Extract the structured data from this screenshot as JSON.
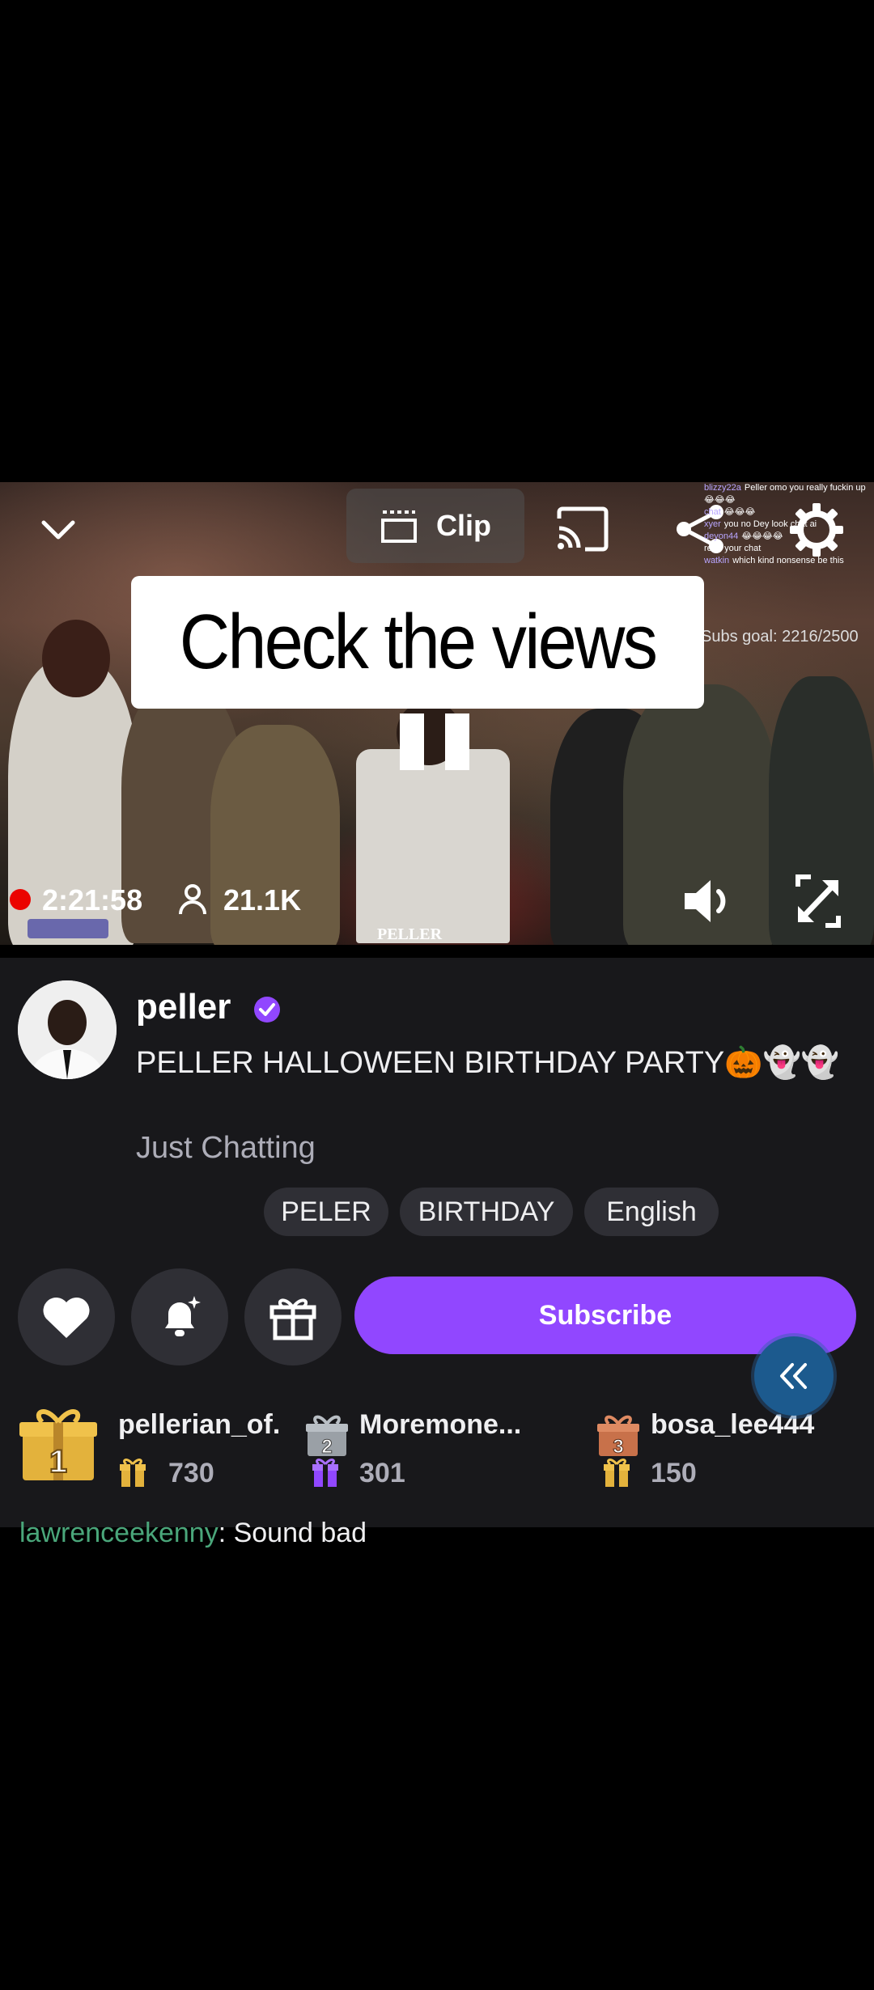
{
  "player": {
    "clip_label": "Clip",
    "caption": "Check the views",
    "uptime": "2:21:58",
    "viewers": "21.1K",
    "watermark": "PELLER",
    "subs_goal": "Subs goal: 2216/2500",
    "overlay_chat": [
      {
        "user": "blizzy22a",
        "text": "Peller omo you really fuckin up"
      },
      {
        "user": "",
        "text": "😂😂😂"
      },
      {
        "user": "chat",
        "text": "😂😂😂"
      },
      {
        "user": "xyer",
        "text": "you no Dey look chat ai"
      },
      {
        "user": "deyon44",
        "text": "😂😂😂😂"
      },
      {
        "user": "",
        "text": "read your chat"
      },
      {
        "user": "watkin",
        "text": "which kind nonsense be this"
      }
    ]
  },
  "channel": {
    "name": "peller",
    "title": "PELLER HALLOWEEN BIRTHDAY PARTY🎃👻👻",
    "category": "Just Chatting",
    "tags": [
      "PELER",
      "BIRTHDAY",
      "English"
    ]
  },
  "actions": {
    "subscribe_label": "Subscribe"
  },
  "gifters": [
    {
      "rank": "1",
      "name": "pellerian_of.",
      "count": "730"
    },
    {
      "rank": "2",
      "name": "Moremone...",
      "count": "301"
    },
    {
      "rank": "3",
      "name": "bosa_lee444",
      "count": "150"
    }
  ],
  "chat_peek": {
    "user": "lawrenceekenny",
    "text": ": Sound bad"
  },
  "colors": {
    "accent": "#9147ff",
    "live": "#eb0400",
    "panel": "#18181b",
    "chip": "#2f2f35"
  },
  "icons": [
    "chevron-down-icon",
    "clip-icon",
    "cast-icon",
    "share-icon",
    "gear-icon",
    "person-icon",
    "volume-icon",
    "fullscreen-icon",
    "verified-icon",
    "heart-icon",
    "bell-icon",
    "gift-icon",
    "double-chevron-left-icon"
  ]
}
